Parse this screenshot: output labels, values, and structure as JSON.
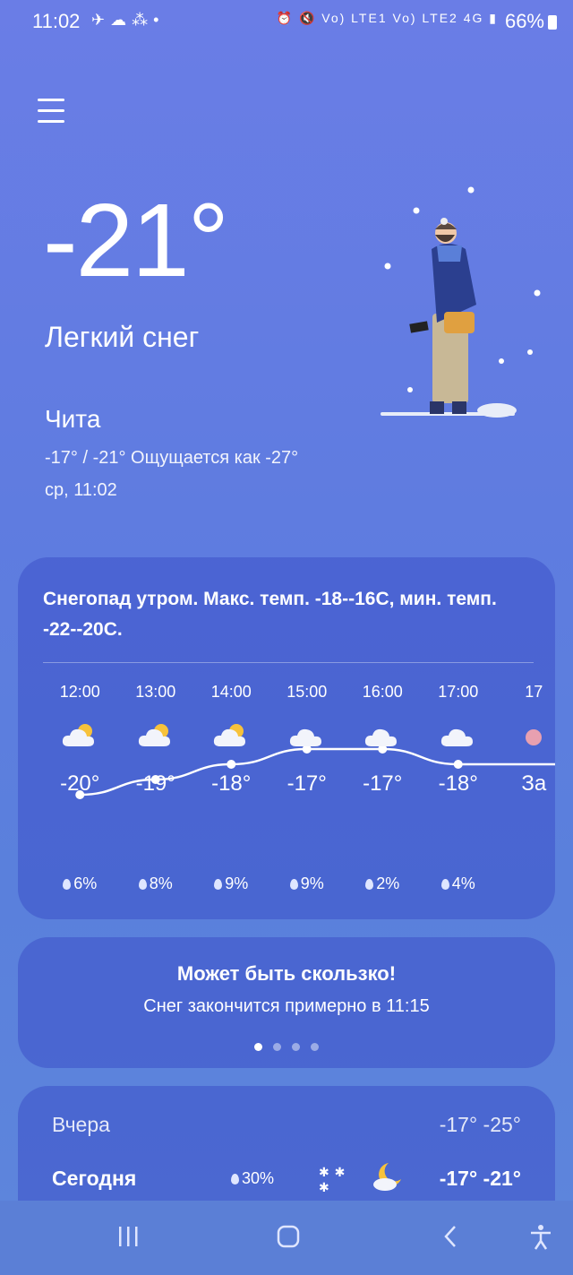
{
  "status_bar": {
    "time": "11:02",
    "left_icons": "telegram-icon, cloud-icon, app-icon, dot",
    "right_icons": "alarm-icon, mute-icon, signal-icon",
    "right_text": "Vo) LTE1 Vo) LTE2 4G",
    "battery": "66%"
  },
  "current": {
    "temperature": "-21°",
    "condition": "Легкий снег",
    "city": "Чита",
    "range_feels": "-17° / -21° Ощущается как -27°",
    "datetime": "ср, 11:02"
  },
  "forecast_card": {
    "summary": "Снегопад утром. Макс. темп. -18--16С, мин. темп. -22--20С.",
    "hours": [
      {
        "time": "12:00",
        "temp": "-20°",
        "precip": "6%",
        "icon": "partly-cloudy-icon",
        "value": -20
      },
      {
        "time": "13:00",
        "temp": "-19°",
        "precip": "8%",
        "icon": "partly-cloudy-icon",
        "value": -19
      },
      {
        "time": "14:00",
        "temp": "-18°",
        "precip": "9%",
        "icon": "partly-cloudy-icon",
        "value": -18
      },
      {
        "time": "15:00",
        "temp": "-17°",
        "precip": "9%",
        "icon": "cloudy-icon",
        "value": -17
      },
      {
        "time": "16:00",
        "temp": "-17°",
        "precip": "2%",
        "icon": "cloudy-icon",
        "value": -17
      },
      {
        "time": "17:00",
        "temp": "-18°",
        "precip": "4%",
        "icon": "cloudy-icon",
        "value": -18
      },
      {
        "time": "17",
        "temp": "За",
        "precip": "",
        "icon": "sunset-icon",
        "value": null
      }
    ]
  },
  "alert_card": {
    "title": "Может быть скользко!",
    "text": "Снег закончится примерно в 11:15",
    "page_dots": 4,
    "active_dot": 1
  },
  "daily": [
    {
      "label": "Вчера",
      "temps": "-17° -25°",
      "precip": "",
      "icon": ""
    },
    {
      "label": "Сегодня",
      "temps": "-17° -21°",
      "precip": "30%",
      "icon": "snow-moon-icon"
    }
  ],
  "colors": {
    "accent_line": "#ffffff",
    "card_bg": "#3c50c8"
  }
}
